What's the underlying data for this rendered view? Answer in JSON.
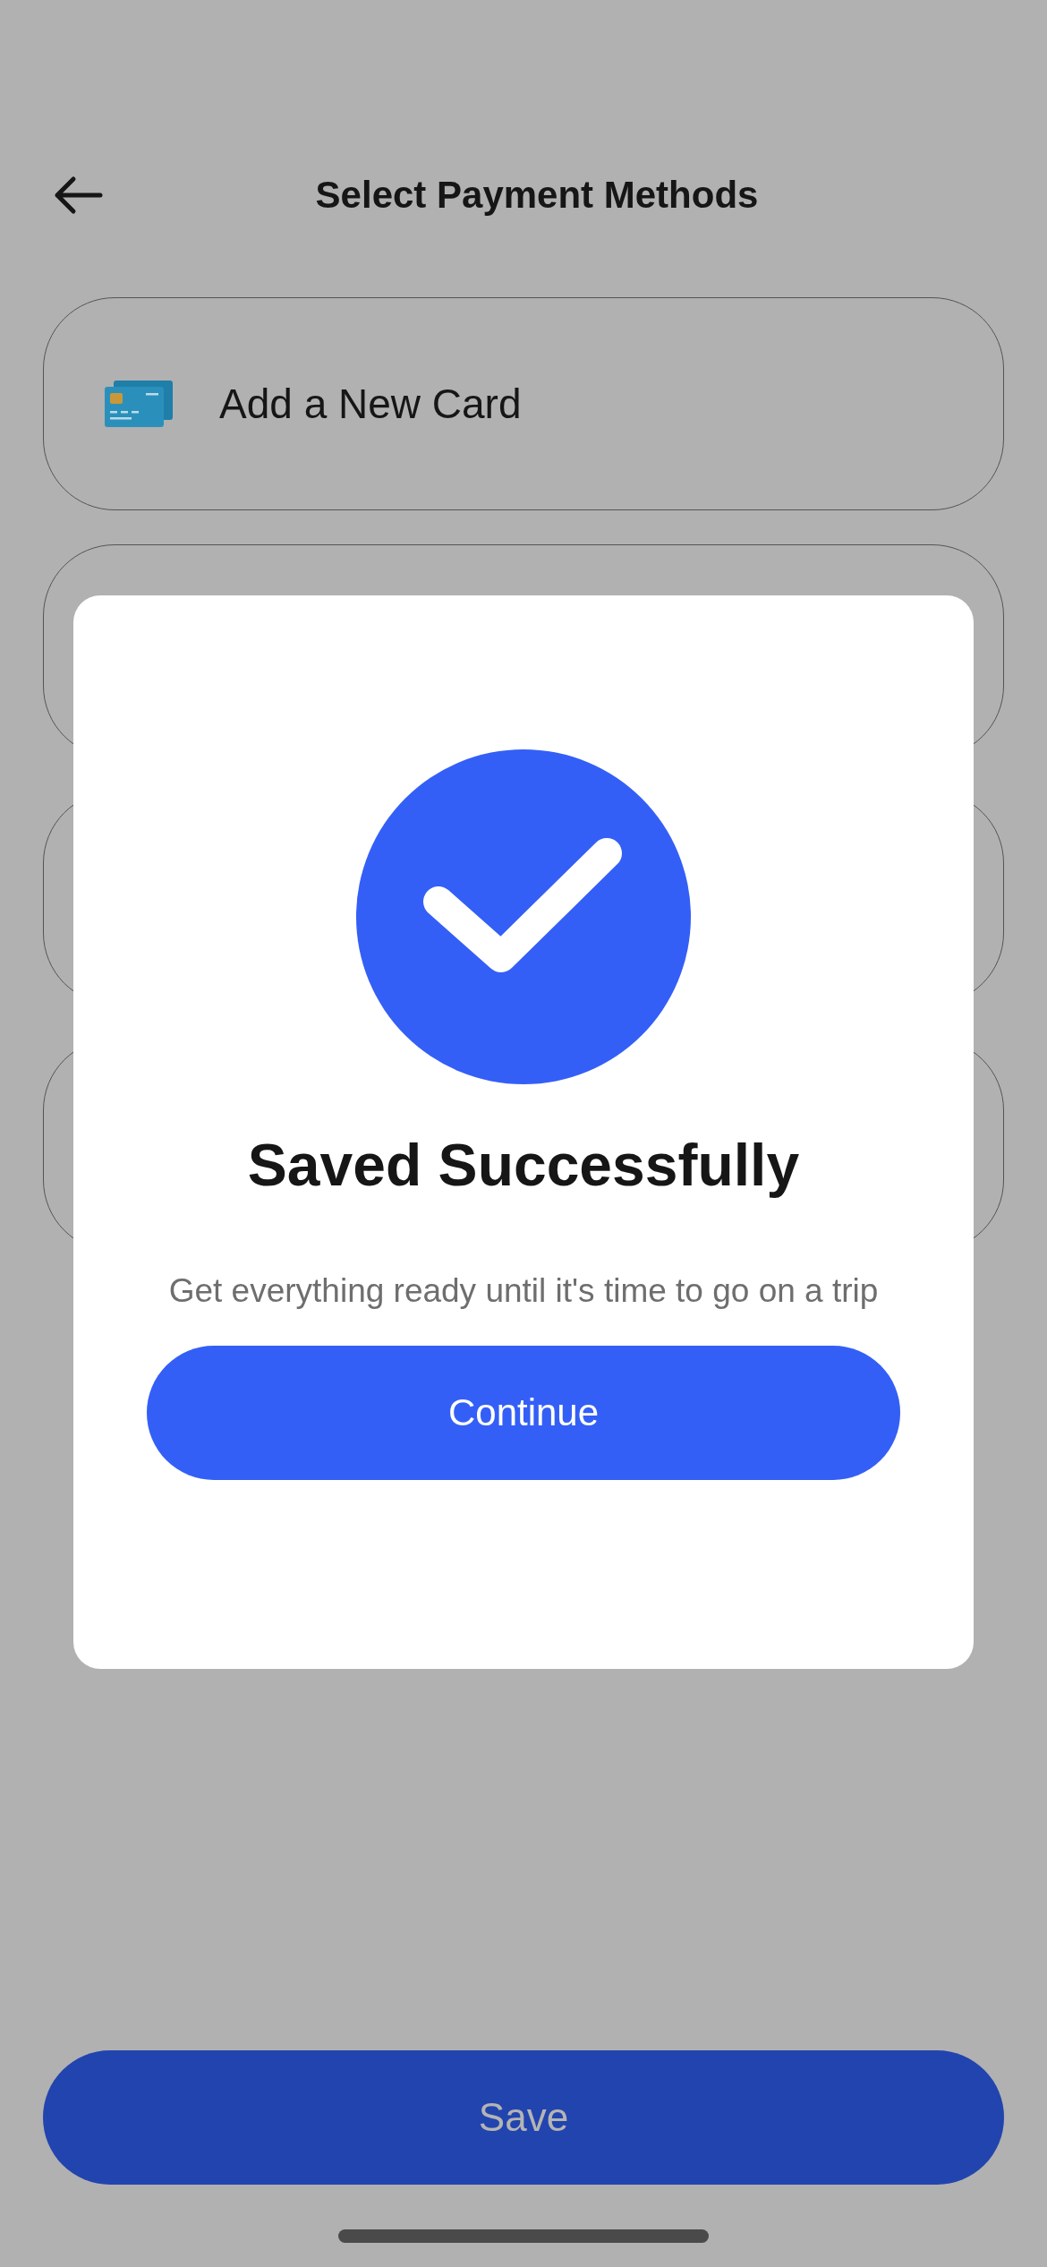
{
  "header": {
    "title": "Select Payment Methods"
  },
  "payment_options": [
    {
      "kind": "add_card",
      "label": "Add a New Card"
    },
    {
      "kind": "option"
    },
    {
      "kind": "option"
    },
    {
      "kind": "option"
    }
  ],
  "dialog": {
    "title": "Saved Successfully",
    "message": "Get everything ready until it's time to go on a trip",
    "button": "Continue"
  },
  "save_button": "Save"
}
